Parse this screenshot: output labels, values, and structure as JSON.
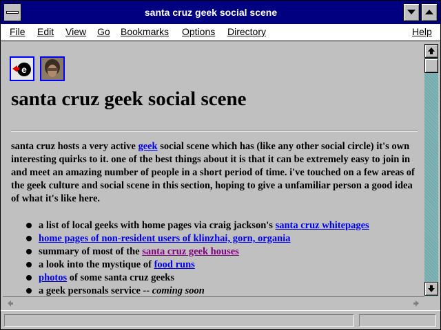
{
  "window": {
    "title": "santa cruz geek social scene"
  },
  "menu": [
    "File",
    "Edit",
    "View",
    "Go",
    "Bookmarks",
    "Options",
    "Directory",
    "Help"
  ],
  "page": {
    "heading": "santa cruz geek social scene",
    "intro": {
      "before_link": "santa cruz hosts a very active ",
      "link": "geek",
      "after_link": " social scene which has (like any other social circle) it's own interesting quirks to it. one of the best things about it is that it can be extremely easy to join in and meet an amazing number of people in a short period of time. i've touched on a few areas of the geek culture and social scene in this section, hoping to give a unfamiliar person a good idea of what it's like here."
    },
    "list": [
      {
        "text": "a list of local geeks with home pages via craig jackson's ",
        "link": "santa cruz whitepages"
      },
      {
        "link": "home pages of non-resident users of klinzhai, gorn, organia"
      },
      {
        "text": "summary of most of the ",
        "link": "santa cruz geek houses"
      },
      {
        "text": "a look into the mystique of ",
        "link": "food runs"
      },
      {
        "link": "photos",
        "after": " of some santa cruz geeks"
      },
      {
        "text": "a geek personals service -- ",
        "italic": "coming soon"
      }
    ]
  },
  "colors": {
    "titlebar": "#000080",
    "link": "#0000ee",
    "visited_link": "#800080",
    "page_bg": "#c0c0c0"
  }
}
